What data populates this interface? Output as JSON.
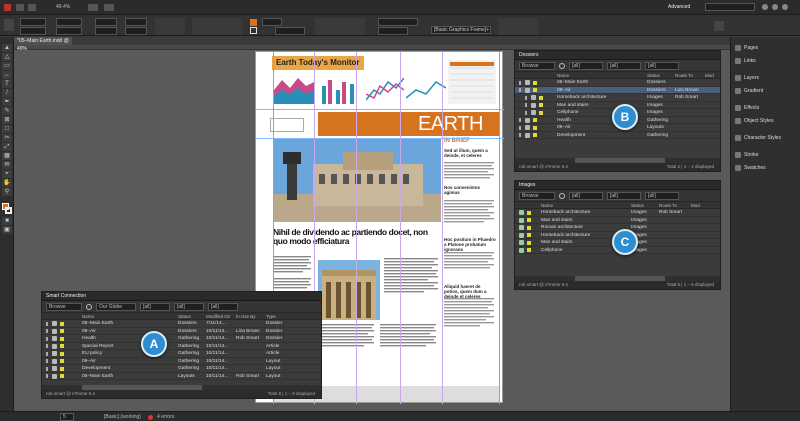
{
  "appbar": {
    "zoom": "49.4%",
    "workspace": "Advanced",
    "search_label": "",
    "style_field": "[Basic Graphics Frame]+"
  },
  "document": {
    "tab_title": "*05–Main Earth.indd @ 49%"
  },
  "dock": {
    "items": [
      "Pages",
      "Links",
      "Layers",
      "Gradient",
      "Effects",
      "Object Styles",
      "Character Styles",
      "Stroke",
      "Swatches"
    ]
  },
  "page": {
    "header_title": "Earth Today's Monitor",
    "banner": "EARTH",
    "in_brief": "IN BRIEF",
    "headline": "Nihil de dividendo ac partiendo docet, non quo modo efficiatura",
    "side_heads": [
      "Sed ut illum, quem a deinde, et celeres",
      "Nos convenistos agimus",
      "Hoc positum in Phaedro a Platone probatum ignorans",
      "Aliquid haeret de potios, quem dum a deinde et celeres"
    ]
  },
  "smart_connection": {
    "title": "Smart Connection",
    "browse": "Browse",
    "filters": [
      "Our Globe",
      "[all]",
      "[all]",
      "[all]"
    ],
    "columns": [
      "Name",
      "Status",
      "Modified On",
      "In Use By",
      "Type"
    ],
    "rows": [
      {
        "name": "05–Main Earth",
        "status": "Dossiers",
        "modified": "7/11/14...",
        "inuse": "",
        "type": "Dossier",
        "color": "#e3d83a"
      },
      {
        "name": "09–Air",
        "status": "Dossiers",
        "modified": "10/11/14...",
        "inuse": "Liza Brown",
        "type": "Dossier",
        "color": "#e3d83a"
      },
      {
        "name": "Health",
        "status": "Gathering",
        "modified": "10/11/14...",
        "inuse": "Rob Smart",
        "type": "Dossier",
        "color": "#e3d83a"
      },
      {
        "name": "Special Report",
        "status": "Gathering",
        "modified": "10/11/14...",
        "inuse": "",
        "type": "Article",
        "color": "#e3d83a"
      },
      {
        "name": "EU policy",
        "status": "Gathering",
        "modified": "10/11/14...",
        "inuse": "",
        "type": "Article",
        "color": "#e3d83a"
      },
      {
        "name": "09–Air",
        "status": "Gathering",
        "modified": "10/11/14...",
        "inuse": "",
        "type": "Layout",
        "color": "#e3d83a"
      },
      {
        "name": "Development",
        "status": "Gathering",
        "modified": "10/11/14...",
        "inuse": "",
        "type": "Layout",
        "color": "#e3d83a"
      },
      {
        "name": "05–Main Earth",
        "status": "Layouts",
        "modified": "10/11/14...",
        "inuse": "Rob Smart",
        "type": "Layout",
        "color": "#e3d83a"
      }
    ],
    "footer_left": "rob smart @ eTrome 9.4",
    "footer_right": "Total 8 | 1 – 8 displayed"
  },
  "dossiers": {
    "title": "Dossiers",
    "browse": "Browse",
    "filters": [
      "[all]",
      "[all]",
      "[all]"
    ],
    "columns": [
      "Name",
      "Status",
      "Route To",
      "Mod"
    ],
    "rows": [
      {
        "name": "05–Main Earth",
        "status": "Dossiers",
        "route": "",
        "sel": false,
        "indent": 0
      },
      {
        "name": "09–Air",
        "status": "Dossiers",
        "route": "Liza Brown",
        "sel": true,
        "indent": 0
      },
      {
        "name": "Horseback architecture",
        "status": "Images",
        "route": "Rob Smart",
        "sel": false,
        "indent": 1
      },
      {
        "name": "Man and stairs",
        "status": "Images",
        "route": "",
        "sel": false,
        "indent": 1
      },
      {
        "name": "Cellphone",
        "status": "Images",
        "route": "",
        "sel": false,
        "indent": 1
      },
      {
        "name": "Health",
        "status": "Gathering",
        "route": "",
        "sel": false,
        "indent": 0
      },
      {
        "name": "09–Air",
        "status": "Layouts",
        "route": "",
        "sel": false,
        "indent": 0
      },
      {
        "name": "Development",
        "status": "Gathering",
        "route": "",
        "sel": false,
        "indent": 0
      }
    ],
    "footer_left": "rob smart @ eTrome 9.4",
    "footer_right": "Total 2 | 1 – 2 displayed"
  },
  "images": {
    "title": "Images",
    "browse": "Browse",
    "filters": [
      "[all]",
      "[all]",
      "[all]"
    ],
    "columns": [
      "Name",
      "Status",
      "Route To",
      "Mod"
    ],
    "rows": [
      {
        "name": "Horseback architecture",
        "status": "Images",
        "route": "Rob Smart"
      },
      {
        "name": "Man and stairs",
        "status": "Images",
        "route": ""
      },
      {
        "name": "Roman architecture",
        "status": "Images",
        "route": ""
      },
      {
        "name": "Horseback architecture",
        "status": "Images",
        "route": ""
      },
      {
        "name": "Man and stairs",
        "status": "Images",
        "route": ""
      },
      {
        "name": "Cellphone",
        "status": "Images",
        "route": ""
      }
    ],
    "footer_left": "rob smart @ eTrome 9.4",
    "footer_right": "Total 6 | 1 – 6 displayed"
  },
  "badges": {
    "a": "A",
    "b": "B",
    "c": "C"
  },
  "statusbar": {
    "page": "5",
    "preflight": "[Basic] (working)",
    "errors": "4 errors"
  },
  "colors": {
    "accent": "#2e8ecf",
    "orange": "#d5731f",
    "selection": "#4a5f7a"
  }
}
